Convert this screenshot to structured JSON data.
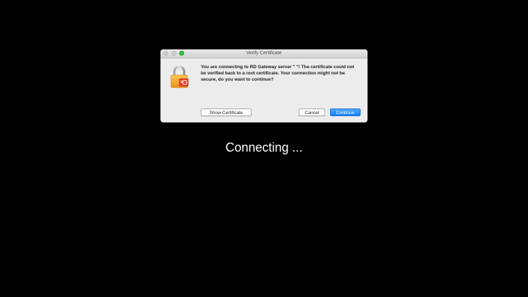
{
  "dialog": {
    "title": "Verify Certificate",
    "message": "You are connecting to RD Gateway server \"                        \"! The certificate could not be verified back to a root certificate. Your connection might not be secure, do you want to continue?",
    "buttons": {
      "show_certificate": "Show Certificate",
      "cancel": "Cancel",
      "continue": "Continue"
    },
    "icon": "lock-certificate-icon"
  },
  "status": {
    "text": "Connecting ..."
  },
  "colors": {
    "background": "#000000",
    "dialog_bg": "#ececec",
    "primary_button": "#1180fa",
    "zoom_button": "#29c23f"
  }
}
